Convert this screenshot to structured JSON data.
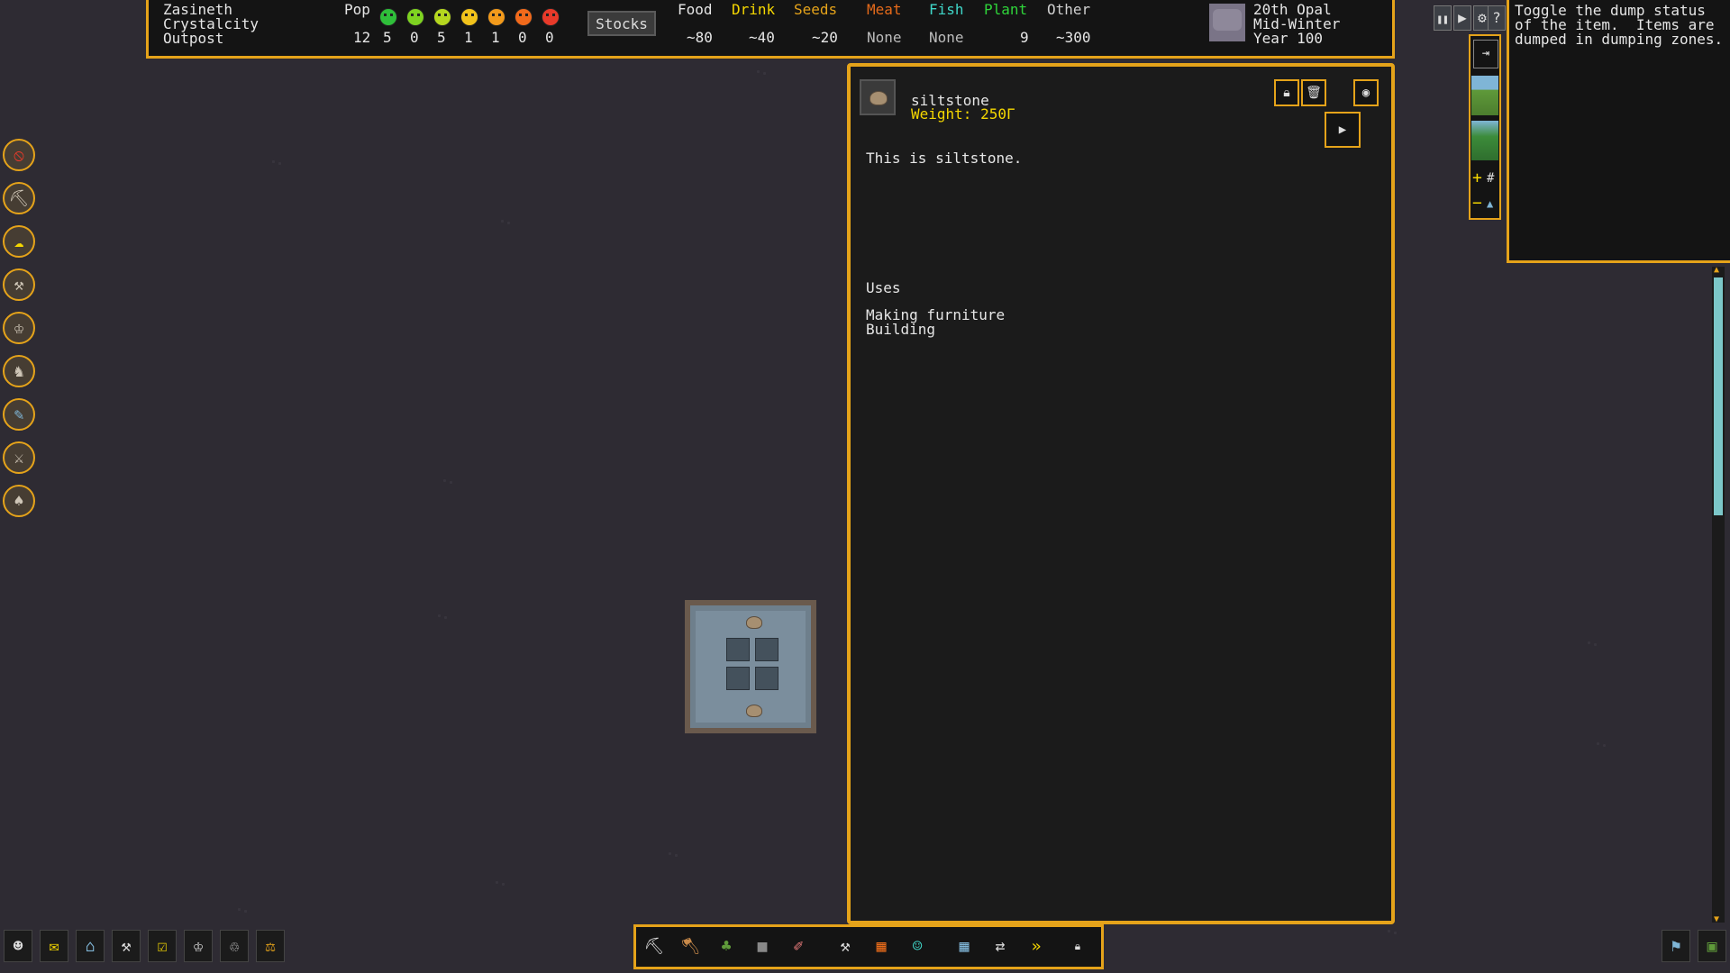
{
  "fort": {
    "name_lines": [
      "Zasineth",
      "Crystalcity",
      "Outpost"
    ]
  },
  "population": {
    "label": "Pop",
    "total": "12",
    "by_mood": [
      {
        "mood": "ecstatic",
        "color": "#2fbf3a",
        "count": "5"
      },
      {
        "mood": "happy",
        "color": "#7ed321",
        "count": "0"
      },
      {
        "mood": "content",
        "color": "#b5d71f",
        "count": "5"
      },
      {
        "mood": "fine",
        "color": "#f2c31b",
        "count": "1"
      },
      {
        "mood": "unhappy",
        "color": "#f29a1b",
        "count": "1"
      },
      {
        "mood": "very-unhappy",
        "color": "#f26a1b",
        "count": "0"
      },
      {
        "mood": "miserable",
        "color": "#e83a2a",
        "count": "0"
      }
    ]
  },
  "stocks_button": "Stocks",
  "resources": [
    {
      "label": "Food",
      "color": "#e6e6e6",
      "value": "~80"
    },
    {
      "label": "Drink",
      "color": "#f5d700",
      "value": "~40"
    },
    {
      "label": "Seeds",
      "color": "#e5a31a",
      "value": "~20"
    },
    {
      "label": "Meat",
      "color": "#e56a1a",
      "value": "None"
    },
    {
      "label": "Fish",
      "color": "#3fd6c8",
      "value": "None"
    },
    {
      "label": "Plant",
      "color": "#2fd43a",
      "value": "9"
    },
    {
      "label": "Other",
      "color": "#cfcfcf",
      "value": "~300"
    }
  ],
  "date": {
    "line1": "20th Opal",
    "line2": "Mid-Winter",
    "line3": "Year 100"
  },
  "top_controls": {
    "pause": "❚❚",
    "play": "▶",
    "settings": "⚙",
    "help": "?"
  },
  "tooltip": {
    "text": "Toggle the dump status\nof the item.  Items are\ndumped in dumping zones."
  },
  "item": {
    "name": "siltstone",
    "weight": "Weight: 250Γ",
    "description": "This is siltstone.",
    "uses_heading": "Uses",
    "uses": [
      "Making furniture",
      "Building"
    ]
  },
  "side_menu": [
    {
      "icon": "cancel-icon"
    },
    {
      "icon": "pickaxe-icon"
    },
    {
      "icon": "weather-icon"
    },
    {
      "icon": "hammer-icon"
    },
    {
      "icon": "crown-icon"
    },
    {
      "icon": "animal-icon"
    },
    {
      "icon": "hoe-icon"
    },
    {
      "icon": "crossed-swords-icon"
    },
    {
      "icon": "shovel-icon"
    }
  ]
}
